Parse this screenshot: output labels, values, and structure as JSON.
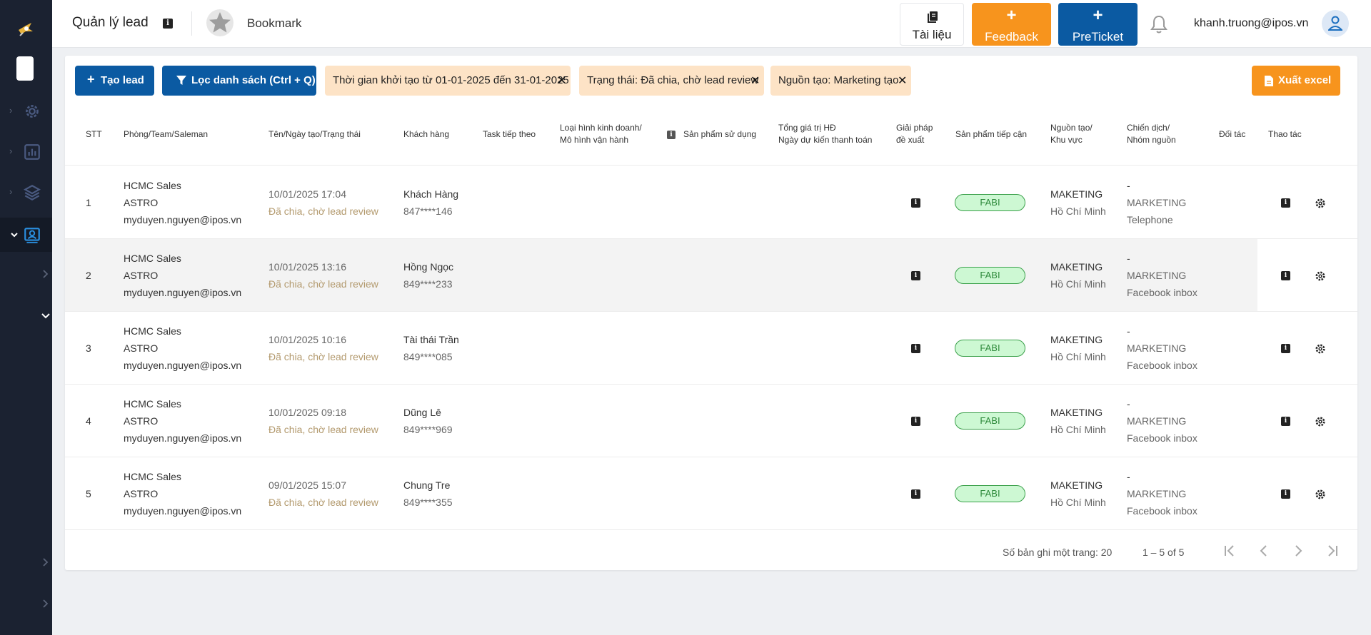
{
  "header": {
    "title": "Quản lý lead",
    "bookmark_label": "Bookmark",
    "doc_label": "Tài liệu",
    "feedback_label": "Feedback",
    "preticket_label": "PreTicket",
    "user_email": "khanh.truong@ipos.vn"
  },
  "toolbar": {
    "create_label": "Tạo lead",
    "filter_label": "Lọc danh sách (Ctrl + Q)",
    "chips": [
      "Thời gian khởi tạo từ 01-01-2025 đến 31-01-2025",
      "Trạng thái: Đã chia, chờ lead review",
      "Nguồn tạo: Marketing tạo"
    ],
    "export_label": "Xuất excel"
  },
  "table": {
    "headers": {
      "stt": "STT",
      "team": "Phòng/Team/Saleman",
      "name": "Tên/Ngày tạo/Trạng thái",
      "customer": "Khách hàng",
      "task": "Task tiếp theo",
      "biz_1": "Loại hình kinh doanh/",
      "biz_2": "Mô hình vận hành",
      "product_used": "Sản phẩm sử dụng",
      "value_1": "Tổng giá trị HĐ",
      "value_2": "Ngày dự kiến thanh toán",
      "solution_1": "Giải pháp",
      "solution_2": "đề xuất",
      "product_approach": "Sản phẩm tiếp cận",
      "source_1": "Nguồn tạo/",
      "source_2": "Khu vực",
      "campaign_1": "Chiến dịch/",
      "campaign_2": "Nhóm nguồn",
      "partner": "Đối tác",
      "actions": "Thao tác"
    },
    "rows": [
      {
        "stt": "1",
        "team": "HCMC Sales",
        "sub_team": "ASTRO",
        "saleman": "myduyen.nguyen@ipos.vn",
        "date": "10/01/2025  17:04",
        "status": "Đã chia, chờ lead review",
        "customer": "Khách Hàng",
        "phone": "847****146",
        "product": "FABI",
        "source": "MAKETING",
        "region": "Hồ Chí Minh",
        "campaign": "-",
        "campaign_group": "MARKETING",
        "channel": "Telephone"
      },
      {
        "stt": "2",
        "team": "HCMC Sales",
        "sub_team": "ASTRO",
        "saleman": "myduyen.nguyen@ipos.vn",
        "date": "10/01/2025  13:16",
        "status": "Đã chia, chờ lead review",
        "customer": "Hồng Ngọc",
        "phone": "849****233",
        "product": "FABI",
        "source": "MAKETING",
        "region": "Hồ Chí Minh",
        "campaign": "-",
        "campaign_group": "MARKETING",
        "channel": "Facebook inbox"
      },
      {
        "stt": "3",
        "team": "HCMC Sales",
        "sub_team": "ASTRO",
        "saleman": "myduyen.nguyen@ipos.vn",
        "date": "10/01/2025  10:16",
        "status": "Đã chia, chờ lead review",
        "customer": "Tài thái Trần",
        "phone": "849****085",
        "product": "FABI",
        "source": "MAKETING",
        "region": "Hồ Chí Minh",
        "campaign": "-",
        "campaign_group": "MARKETING",
        "channel": "Facebook inbox"
      },
      {
        "stt": "4",
        "team": "HCMC Sales",
        "sub_team": "ASTRO",
        "saleman": "myduyen.nguyen@ipos.vn",
        "date": "10/01/2025  09:18",
        "status": "Đã chia, chờ lead review",
        "customer": "Dũng Lê",
        "phone": "849****969",
        "product": "FABI",
        "source": "MAKETING",
        "region": "Hồ Chí Minh",
        "campaign": "-",
        "campaign_group": "MARKETING",
        "channel": "Facebook inbox"
      },
      {
        "stt": "5",
        "team": "HCMC Sales",
        "sub_team": "ASTRO",
        "saleman": "myduyen.nguyen@ipos.vn",
        "date": "09/01/2025  15:07",
        "status": "Đã chia, chờ lead review",
        "customer": "Chung Tre",
        "phone": "849****355",
        "product": "FABI",
        "source": "MAKETING",
        "region": "Hồ Chí Minh",
        "campaign": "-",
        "campaign_group": "MARKETING",
        "channel": "Facebook inbox"
      }
    ]
  },
  "pagination": {
    "per_page_label": "Số bản ghi một trang: 20",
    "range": "1 – 5 of 5"
  },
  "colors": {
    "primary": "#0b5aa2",
    "accent": "#f7941d",
    "sidebar": "#1b2231",
    "chip": "#fde3c6",
    "badge": "#cdf8d3"
  },
  "icons": [
    "logo-icon",
    "gear-icon",
    "chart-icon",
    "layers-icon",
    "lead-icon",
    "star-icon",
    "book-icon",
    "bell-icon",
    "user-icon",
    "filter-icon",
    "file-icon",
    "info-icon",
    "close-icon",
    "first-page-icon",
    "prev-page-icon",
    "next-page-icon",
    "last-page-icon"
  ]
}
